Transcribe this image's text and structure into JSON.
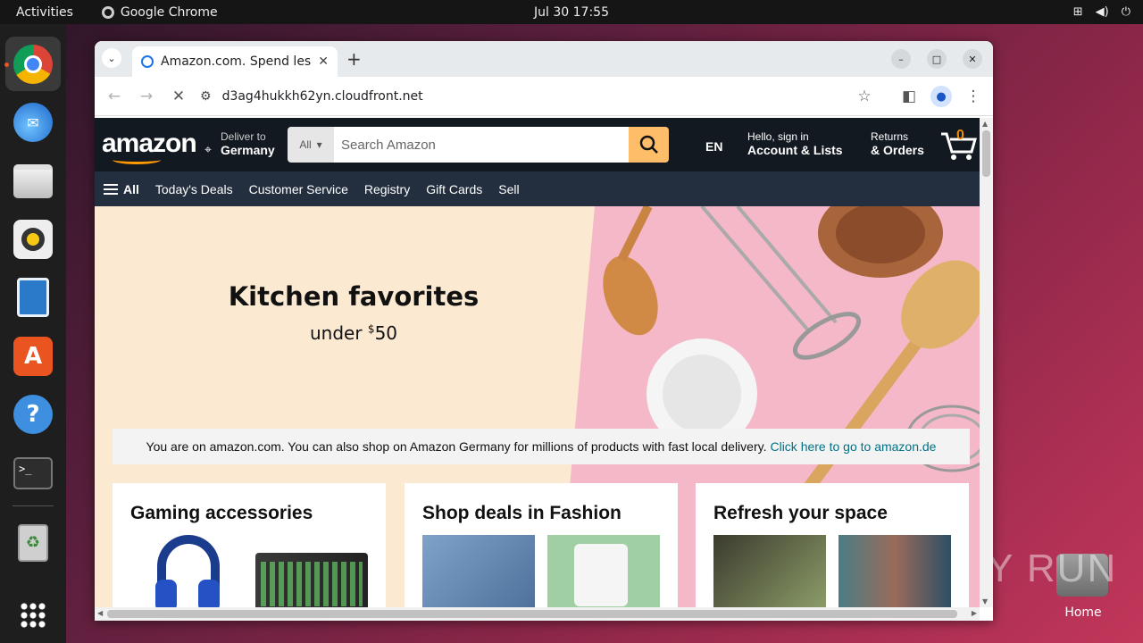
{
  "topbar": {
    "activities": "Activities",
    "app": "Google Chrome",
    "clock": "Jul 30  17:55"
  },
  "browser": {
    "tab_title": "Amazon.com. Spend less. Smile more.",
    "url": "d3ag4hukkh62yn.cloudfront.net"
  },
  "amazon": {
    "logo": "amazon",
    "deliver_line1": "Deliver to",
    "deliver_line2": "Germany",
    "search_category": "All",
    "search_placeholder": "Search Amazon",
    "lang": "EN",
    "account_line1": "Hello, sign in",
    "account_line2": "Account & Lists",
    "returns_line1": "Returns",
    "returns_line2": "& Orders",
    "cart_count": "0",
    "nav": {
      "all": "All",
      "links": [
        "Today's Deals",
        "Customer Service",
        "Registry",
        "Gift Cards",
        "Sell"
      ]
    },
    "hero": {
      "title": "Kitchen favorites",
      "sub_prefix": "under ",
      "sub_currency": "$",
      "sub_amount": "50"
    },
    "notice": {
      "text": "You are on amazon.com. You can also shop on Amazon Germany for millions of products with fast local delivery.",
      "link": "Click here to go to amazon.de"
    },
    "cards": [
      {
        "title": "Gaming accessories"
      },
      {
        "title": "Shop deals in Fashion"
      },
      {
        "title": "Refresh your space"
      }
    ]
  },
  "desktop": {
    "home_label": "Home",
    "watermark": "ANY RUN"
  },
  "colors": {
    "amazon_dark": "#131921",
    "amazon_nav": "#232f3e",
    "amazon_orange": "#febd69",
    "link": "#007185",
    "hero_pink": "#f4b8c8"
  }
}
